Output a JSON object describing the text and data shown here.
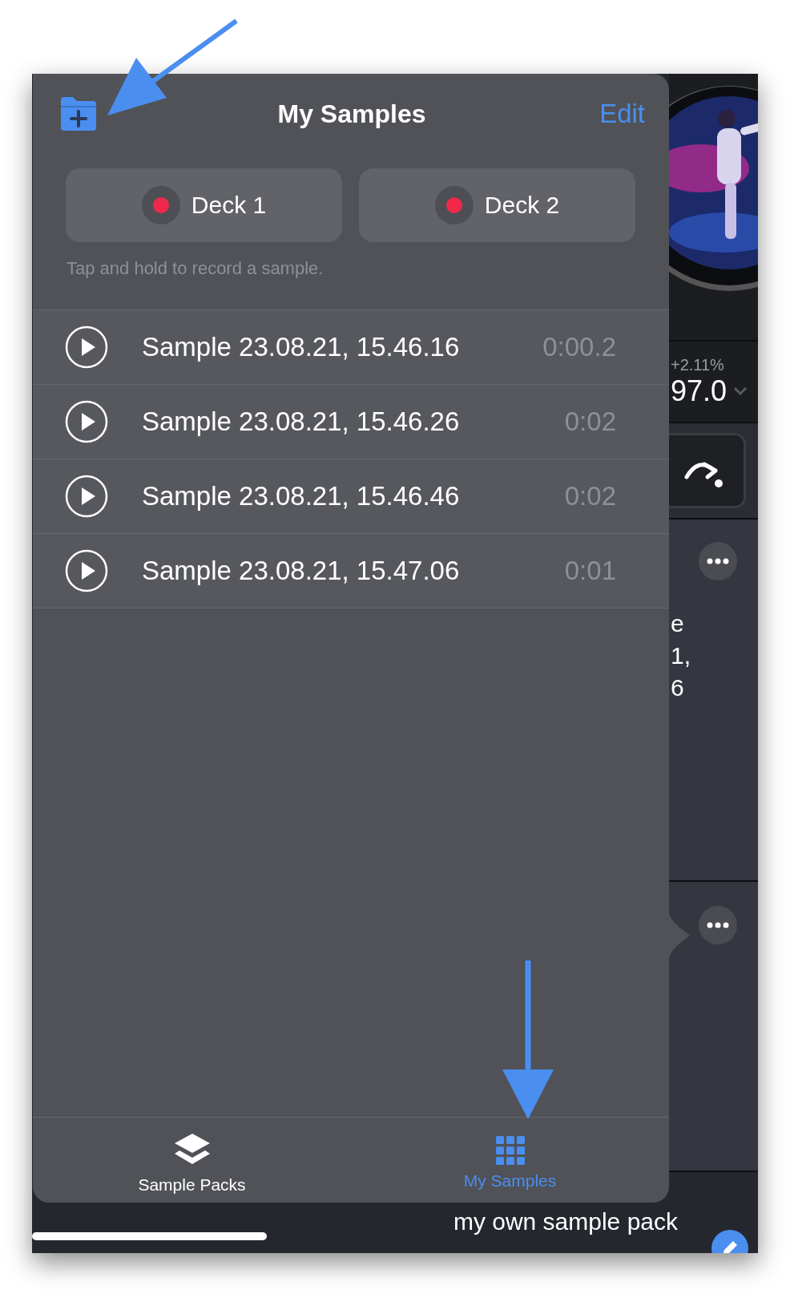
{
  "popover": {
    "title": "My Samples",
    "edit": "Edit",
    "decks": [
      {
        "label": "Deck 1"
      },
      {
        "label": "Deck 2"
      }
    ],
    "hint": "Tap and hold to record a sample.",
    "samples": [
      {
        "name": "Sample 23.08.21, 15.46.16",
        "duration": "0:00.2"
      },
      {
        "name": "Sample 23.08.21, 15.46.26",
        "duration": "0:02"
      },
      {
        "name": "Sample 23.08.21, 15.46.46",
        "duration": "0:02"
      },
      {
        "name": "Sample 23.08.21, 15.47.06",
        "duration": "0:01"
      }
    ],
    "tabs": [
      {
        "label": "Sample Packs",
        "kind": "layers",
        "selected": false
      },
      {
        "label": "My Samples",
        "kind": "grid",
        "selected": true
      }
    ]
  },
  "background": {
    "pitch": "+2.11%",
    "tempo": "97.0",
    "fragments": [
      "e",
      "1,",
      "6"
    ],
    "pack_title": "my own sample pack"
  }
}
